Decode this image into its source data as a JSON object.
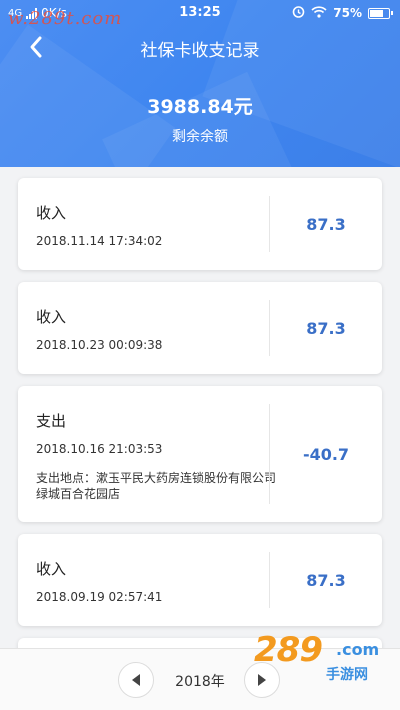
{
  "status_bar": {
    "network": "4G",
    "speed": "0K/s",
    "time": "13:25",
    "battery": "75%",
    "battery_level": 0.75
  },
  "watermark": "w.289t.com",
  "nav": {
    "title": "社保卡收支记录"
  },
  "balance": {
    "amount": "3988.84元",
    "label": "剩余余额"
  },
  "records": [
    {
      "type": "收入",
      "time": "2018.11.14 17:34:02",
      "amount": "87.3"
    },
    {
      "type": "收入",
      "time": "2018.10.23 00:09:38",
      "amount": "87.3"
    },
    {
      "type": "支出",
      "time": "2018.10.16 21:03:53",
      "location": "支出地点：漱玉平民大药房连锁股份有限公司绿城百合花园店",
      "amount": "-40.7"
    },
    {
      "type": "收入",
      "time": "2018.09.19 02:57:41",
      "amount": "87.3"
    }
  ],
  "pager": {
    "year": "2018年"
  },
  "logo": {
    "number": "289",
    "domain": ".com",
    "text": "手游网"
  },
  "colors": {
    "header": "#4088f0",
    "amount": "#3a6fc7",
    "logo_orange": "#f39a1f",
    "logo_blue": "#3a8fe0"
  }
}
